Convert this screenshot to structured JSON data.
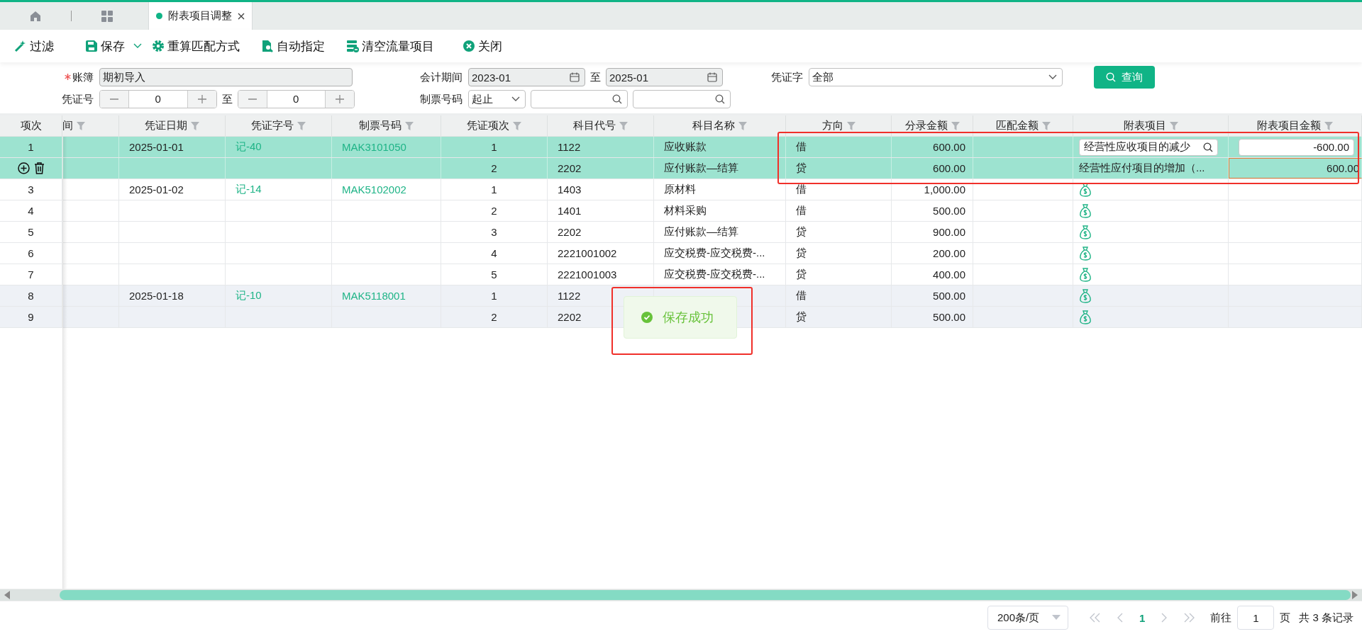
{
  "tabs": [
    {
      "label": "附表项目调整",
      "selected": true
    }
  ],
  "toolbar": [
    {
      "kind": "filter",
      "label": "过滤",
      "has_menu": false
    },
    {
      "kind": "save",
      "label": "保存",
      "has_menu": true
    },
    {
      "kind": "gear",
      "label": "重算匹配方式",
      "has_menu": false
    },
    {
      "kind": "doc",
      "label": "自动指定",
      "has_menu": false
    },
    {
      "kind": "clear",
      "label": "清空流量项目",
      "has_menu": false
    },
    {
      "kind": "close",
      "label": "关闭",
      "has_menu": false
    }
  ],
  "filters": {
    "account": {
      "label": "账簿",
      "required": true,
      "value": "期初导入"
    },
    "voucher_no": {
      "label": "凭证号",
      "from": "0",
      "to_label": "至",
      "to": "0"
    },
    "period": {
      "label": "会计期间",
      "from": "2023-01",
      "to_label": "至",
      "to": "2025-01"
    },
    "ticket_no": {
      "label": "制票号码",
      "mode": "起止"
    },
    "voucher_word": {
      "label": "凭证字",
      "value": "全部"
    },
    "query_button": "查询"
  },
  "table": {
    "columns": [
      {
        "label": "项次",
        "filterable": false
      },
      {
        "label": "间",
        "filterable": true
      },
      {
        "label": "凭证日期",
        "filterable": true
      },
      {
        "label": "凭证字号",
        "filterable": true
      },
      {
        "label": "制票号码",
        "filterable": true
      },
      {
        "label": "凭证项次",
        "filterable": true
      },
      {
        "label": "科目代号",
        "filterable": true
      },
      {
        "label": "科目名称",
        "filterable": true
      },
      {
        "label": "方向",
        "filterable": true
      },
      {
        "label": "分录金额",
        "filterable": true
      },
      {
        "label": "匹配金额",
        "filterable": true
      },
      {
        "label": "附表项目",
        "filterable": true
      },
      {
        "label": "附表项目金额",
        "filterable": true
      }
    ],
    "rows": [
      {
        "kind": "number",
        "no": "1",
        "date": "2025-01-01",
        "voucher": "记-40",
        "ticket": "MAK3101050",
        "seq": "1",
        "code": "1122",
        "name": "应收账款",
        "dir": "借",
        "amount": "600.00",
        "item": {
          "kind": "search_input",
          "value": "经营性应收项目的减少"
        },
        "item_amount": {
          "kind": "input",
          "value": "-600.00"
        },
        "selected": true,
        "shaded": false
      },
      {
        "kind": "actions",
        "seq": "2",
        "code": "2202",
        "name": "应付账款—结算",
        "dir": "贷",
        "amount": "600.00",
        "item": {
          "kind": "text",
          "value": "经营性应付项目的增加（..."
        },
        "item_amount": {
          "kind": "focused",
          "value": "600.00"
        },
        "selected": true,
        "shaded": false
      },
      {
        "kind": "number",
        "no": "3",
        "date": "2025-01-02",
        "voucher": "记-14",
        "ticket": "MAK5102002",
        "seq": "1",
        "code": "1403",
        "name": "原材料",
        "dir": "借",
        "amount": "1,000.00",
        "item": {
          "kind": "icon"
        },
        "selected": false,
        "shaded": false
      },
      {
        "kind": "number",
        "no": "4",
        "seq": "2",
        "code": "1401",
        "name": "材料采购",
        "dir": "借",
        "amount": "500.00",
        "item": {
          "kind": "icon"
        },
        "selected": false,
        "shaded": false
      },
      {
        "kind": "number",
        "no": "5",
        "seq": "3",
        "code": "2202",
        "name": "应付账款—结算",
        "dir": "贷",
        "amount": "900.00",
        "item": {
          "kind": "icon"
        },
        "selected": false,
        "shaded": false
      },
      {
        "kind": "number",
        "no": "6",
        "seq": "4",
        "code": "2221001002",
        "name": "应交税费-应交税费-...",
        "dir": "贷",
        "amount": "200.00",
        "item": {
          "kind": "icon"
        },
        "selected": false,
        "shaded": false
      },
      {
        "kind": "number",
        "no": "7",
        "seq": "5",
        "code": "2221001003",
        "name": "应交税费-应交税费-...",
        "dir": "贷",
        "amount": "400.00",
        "item": {
          "kind": "icon"
        },
        "selected": false,
        "shaded": false
      },
      {
        "kind": "number",
        "no": "8",
        "date": "2025-01-18",
        "voucher": "记-10",
        "ticket": "MAK5118001",
        "seq": "1",
        "code": "1122",
        "dir": "借",
        "amount": "500.00",
        "item": {
          "kind": "icon"
        },
        "selected": false,
        "shaded": true
      },
      {
        "kind": "number",
        "no": "9",
        "seq": "2",
        "code": "2202",
        "dir": "贷",
        "amount": "500.00",
        "item": {
          "kind": "icon"
        },
        "selected": false,
        "shaded": true
      }
    ]
  },
  "toast": {
    "message": "保存成功"
  },
  "pagination": {
    "page_size": "200条/页",
    "current": "1",
    "goto_label": "前往",
    "goto_value": "1",
    "page_unit": "页",
    "total": "共 3 条记录"
  }
}
